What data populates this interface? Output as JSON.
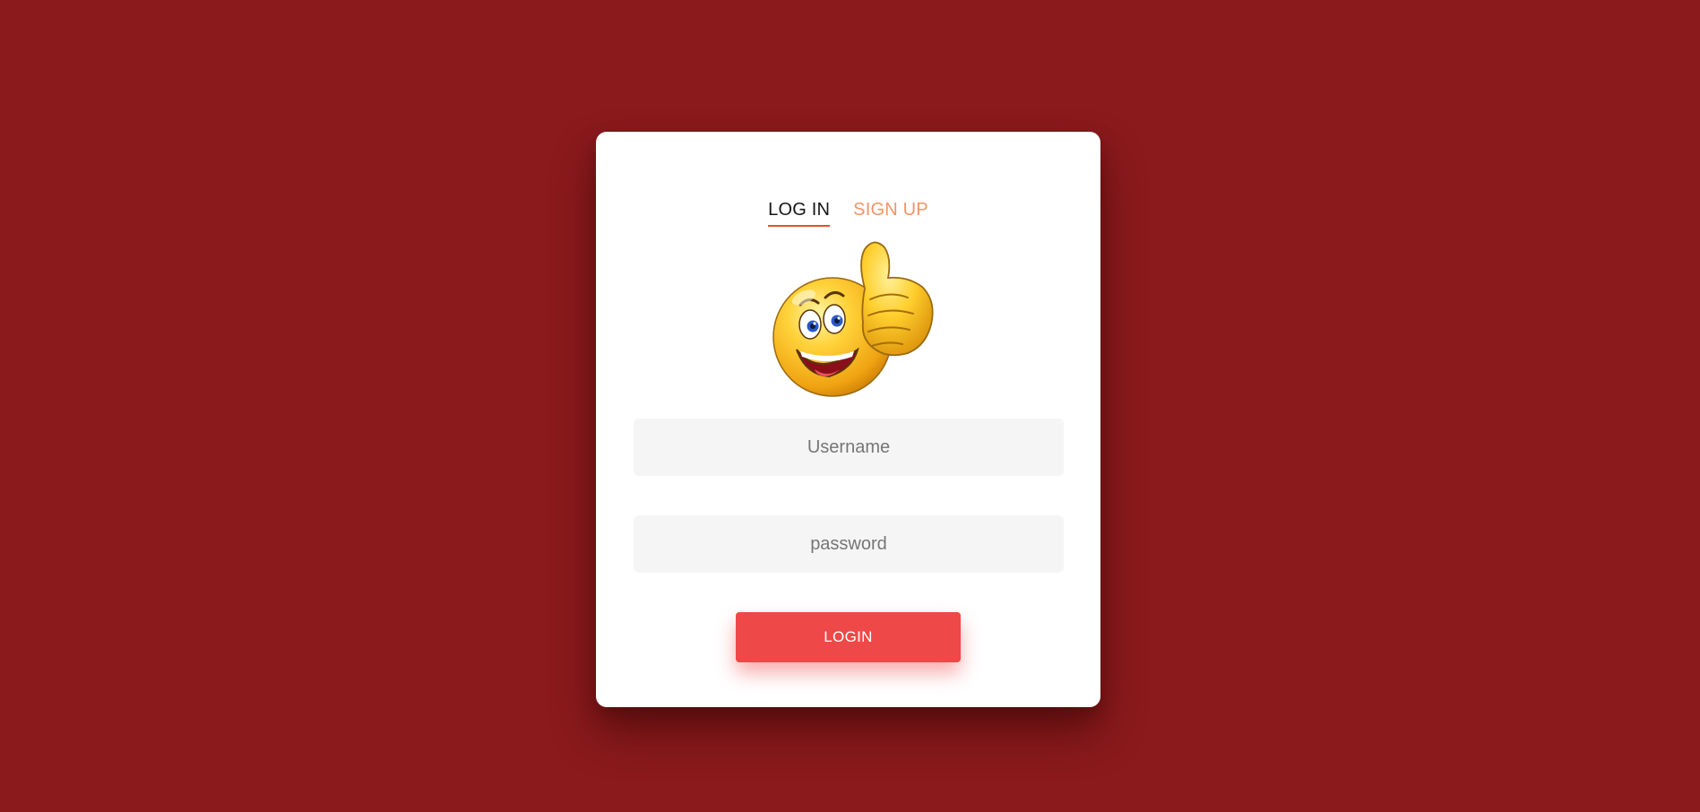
{
  "tabs": {
    "login_label": "LOG IN",
    "signup_label": "SIGN UP"
  },
  "emoji": {
    "icon": "thumbs-up-smiley-icon"
  },
  "form": {
    "username_placeholder": "Username",
    "password_placeholder": "password",
    "username_value": "",
    "password_value": ""
  },
  "button": {
    "login_label": "LOGIN"
  },
  "colors": {
    "background": "#8b1a1c",
    "card": "#ffffff",
    "accent_underline": "#e5502c",
    "signup_text": "#f29466",
    "button": "#ef4848",
    "input_bg": "#f5f5f5"
  }
}
